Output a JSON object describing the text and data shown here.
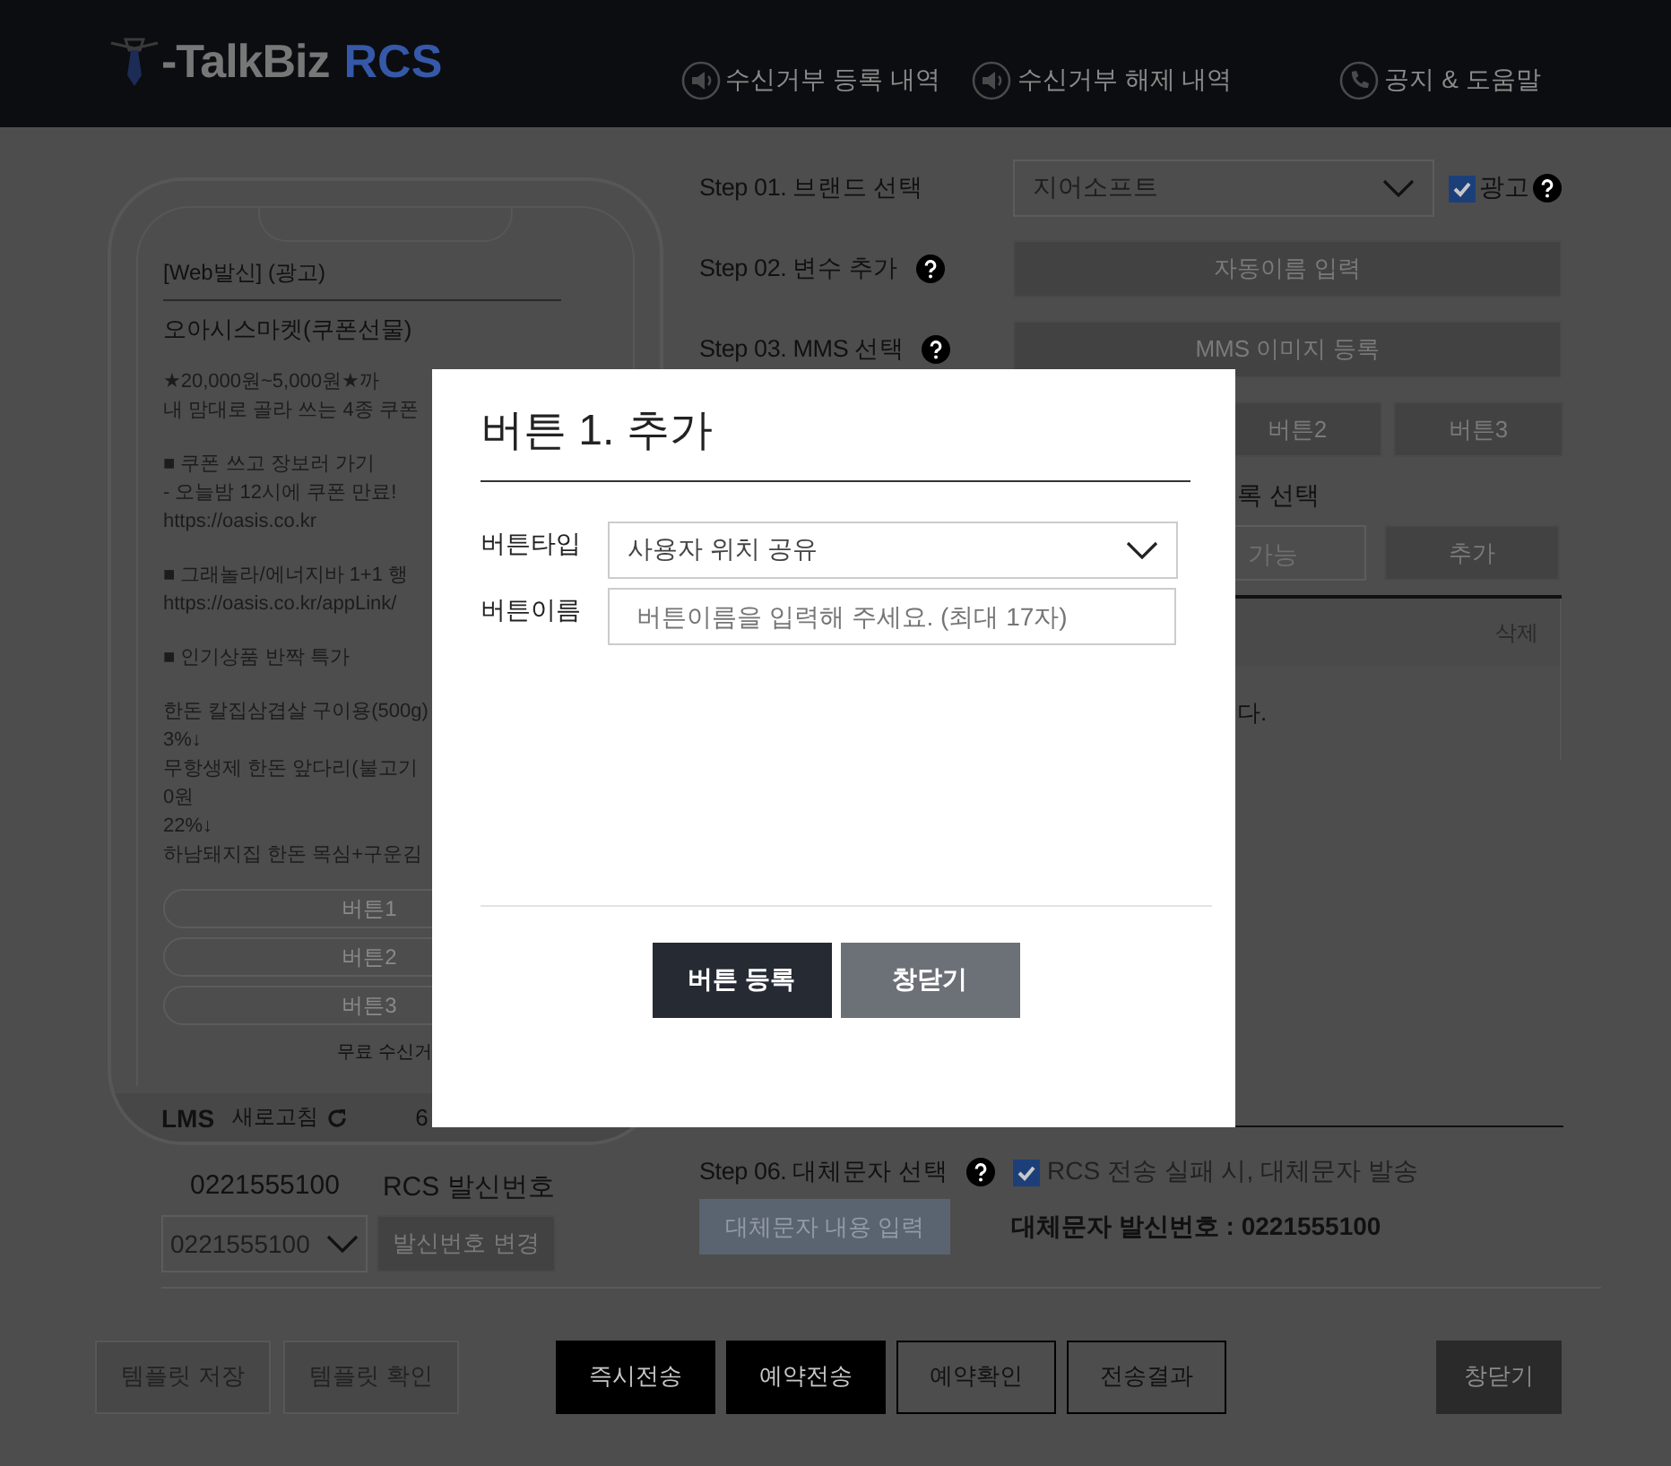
{
  "header": {
    "logo_prefix": "-TalkBiz",
    "logo_suffix": "RCS",
    "nav": [
      {
        "label": "수신거부 등록 내역"
      },
      {
        "label": "수신거부 해제 내역"
      },
      {
        "label": "공지 & 도움말"
      }
    ]
  },
  "preview": {
    "sender_line": "[Web발신] (광고)",
    "title": "오아시스마켓(쿠폰선물)",
    "paragraphs": [
      [
        "★20,000원~5,000원★까",
        "내 맘대로 골라 쓰는 4종 쿠폰"
      ],
      [
        "■ 쿠폰 쓰고 장보러 가기",
        "- 오늘밤 12시에 쿠폰 만료!",
        "https://oasis.co.kr"
      ],
      [
        "■ 그래놀라/에너지바 1+1 행",
        "https://oasis.co.kr/appLink/"
      ],
      [
        "■ 인기상품 반짝 특가"
      ],
      [
        "한돈 칼집삼겹살 구이용(500g)",
        "3%↓",
        "무항생제 한돈 앞다리(불고기",
        "0원",
        "22%↓",
        "하남돼지집 한돈 목심+구운김"
      ]
    ],
    "buttons": [
      "버튼1",
      "버튼2",
      "버튼3"
    ],
    "unsubscribe": "무료 수신거",
    "message_type": "LMS",
    "refresh": "새로고침",
    "counter": "6"
  },
  "sender": {
    "number": "0221555100",
    "label": "RCS 발신번호",
    "select_value": "0221555100",
    "change_button": "발신번호 변경"
  },
  "step1": {
    "label": "Step 01. 브랜드 선택",
    "brand": "지어소프트",
    "ad": {
      "label": "광고",
      "checked": true
    }
  },
  "step2": {
    "label": "Step 02. 변수 추가",
    "button": "자동이름 입력"
  },
  "step3": {
    "label": "Step 03. MMS 선택",
    "button": "MMS 이미지 등록"
  },
  "button_tabs": [
    "버튼2",
    "버튼3"
  ],
  "step5": {
    "label": "록 선택",
    "placeholder": "가능",
    "add_button": "추가"
  },
  "list_table": {
    "columns": [
      "삭제"
    ],
    "message": "다."
  },
  "step6": {
    "label": "Step 06. 대체문자 선택",
    "fallback": {
      "label": "RCS 전송 실패 시, 대체문자 발송",
      "checked": true
    },
    "button": "대체문자 내용 입력",
    "sender_line": "대체문자 발신번호 : 0221555100"
  },
  "footer": {
    "template_buttons": [
      "템플릿 저장",
      "템플릿 확인"
    ],
    "send_buttons": [
      {
        "label": "즉시전송",
        "kind": "filled"
      },
      {
        "label": "예약전송",
        "kind": "filled"
      },
      {
        "label": "예약확인",
        "kind": "outline"
      },
      {
        "label": "전송결과",
        "kind": "outline"
      }
    ],
    "close": "창닫기"
  },
  "modal": {
    "title": "버튼 1. 추가",
    "fields": [
      {
        "label": "버튼타입",
        "kind": "select",
        "value": "사용자 위치 공유"
      },
      {
        "label": "버튼이름",
        "kind": "input",
        "placeholder": "버튼이름을 입력해 주세요. (최대 17자)"
      }
    ],
    "buttons": [
      {
        "label": "버튼 등록",
        "kind": "primary"
      },
      {
        "label": "창닫기",
        "kind": "secondary"
      }
    ]
  }
}
